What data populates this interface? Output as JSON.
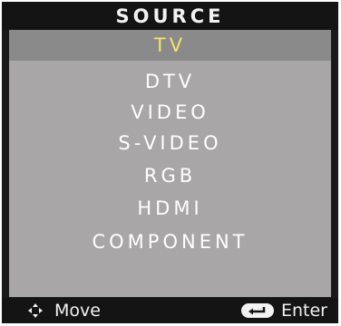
{
  "menu": {
    "title": "SOURCE",
    "selected_index": 0,
    "items": [
      {
        "label": "TV"
      },
      {
        "label": "DTV"
      },
      {
        "label": "VIDEO"
      },
      {
        "label": "S-VIDEO"
      },
      {
        "label": "RGB"
      },
      {
        "label": "HDMI"
      },
      {
        "label": "COMPONENT"
      }
    ]
  },
  "footer": {
    "move_label": "Move",
    "move_icon": "four-way-arrow-icon",
    "enter_label": "Enter",
    "enter_icon": "enter-return-icon"
  },
  "colors": {
    "frame": "#1a1a1a",
    "panel": "#a8a6a6",
    "selected_bar": "#8a8a8a",
    "selected_text": "#f4e36a",
    "text": "#ffffff"
  }
}
